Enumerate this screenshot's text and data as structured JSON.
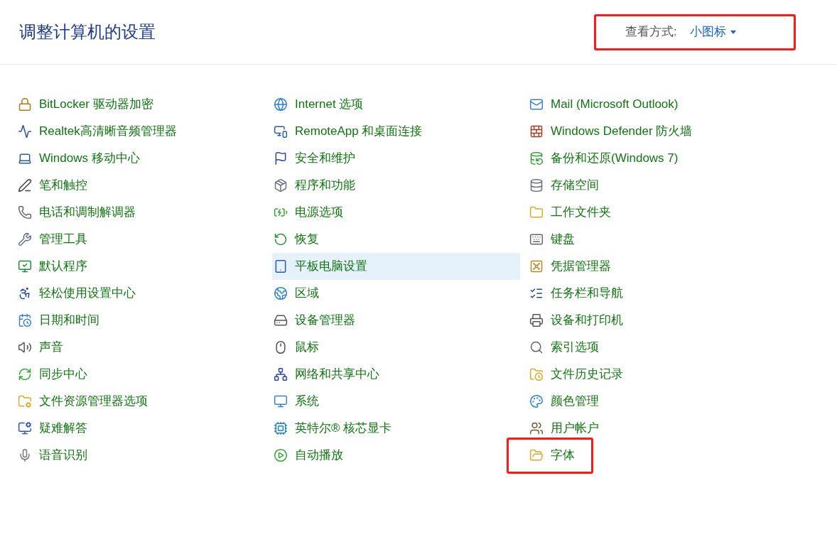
{
  "title": "调整计算机的设置",
  "view_by": {
    "label": "查看方式:",
    "value": "小图标",
    "marked": true
  },
  "columns": [
    [
      {
        "label": "BitLocker 驱动器加密",
        "selected": false,
        "marked": false
      },
      {
        "label": "Realtek高清晰音频管理器",
        "selected": false,
        "marked": false
      },
      {
        "label": "Windows 移动中心",
        "selected": false,
        "marked": false
      },
      {
        "label": "笔和触控",
        "selected": false,
        "marked": false
      },
      {
        "label": "电话和调制解调器",
        "selected": false,
        "marked": false
      },
      {
        "label": "管理工具",
        "selected": false,
        "marked": false
      },
      {
        "label": "默认程序",
        "selected": false,
        "marked": false
      },
      {
        "label": "轻松使用设置中心",
        "selected": false,
        "marked": false
      },
      {
        "label": "日期和时间",
        "selected": false,
        "marked": false
      },
      {
        "label": "声音",
        "selected": false,
        "marked": false
      },
      {
        "label": "同步中心",
        "selected": false,
        "marked": false
      },
      {
        "label": "文件资源管理器选项",
        "selected": false,
        "marked": false
      },
      {
        "label": "疑难解答",
        "selected": false,
        "marked": false
      },
      {
        "label": "语音识别",
        "selected": false,
        "marked": false
      }
    ],
    [
      {
        "label": "Internet 选项",
        "selected": false,
        "marked": false
      },
      {
        "label": "RemoteApp 和桌面连接",
        "selected": false,
        "marked": false
      },
      {
        "label": "安全和维护",
        "selected": false,
        "marked": false
      },
      {
        "label": "程序和功能",
        "selected": false,
        "marked": false
      },
      {
        "label": "电源选项",
        "selected": false,
        "marked": false
      },
      {
        "label": "恢复",
        "selected": false,
        "marked": false
      },
      {
        "label": "平板电脑设置",
        "selected": true,
        "marked": false
      },
      {
        "label": "区域",
        "selected": false,
        "marked": false
      },
      {
        "label": "设备管理器",
        "selected": false,
        "marked": false
      },
      {
        "label": "鼠标",
        "selected": false,
        "marked": false
      },
      {
        "label": "网络和共享中心",
        "selected": false,
        "marked": false
      },
      {
        "label": "系统",
        "selected": false,
        "marked": false
      },
      {
        "label": "英特尔® 核芯显卡",
        "selected": false,
        "marked": false
      },
      {
        "label": "自动播放",
        "selected": false,
        "marked": false
      }
    ],
    [
      {
        "label": "Mail (Microsoft Outlook)",
        "selected": false,
        "marked": false
      },
      {
        "label": "Windows Defender 防火墙",
        "selected": false,
        "marked": false
      },
      {
        "label": "备份和还原(Windows 7)",
        "selected": false,
        "marked": false
      },
      {
        "label": "存储空间",
        "selected": false,
        "marked": false
      },
      {
        "label": "工作文件夹",
        "selected": false,
        "marked": false
      },
      {
        "label": "键盘",
        "selected": false,
        "marked": false
      },
      {
        "label": "凭据管理器",
        "selected": false,
        "marked": false
      },
      {
        "label": "任务栏和导航",
        "selected": false,
        "marked": false
      },
      {
        "label": "设备和打印机",
        "selected": false,
        "marked": false
      },
      {
        "label": "索引选项",
        "selected": false,
        "marked": false
      },
      {
        "label": "文件历史记录",
        "selected": false,
        "marked": false
      },
      {
        "label": "颜色管理",
        "selected": false,
        "marked": false
      },
      {
        "label": "用户帐户",
        "selected": false,
        "marked": false
      },
      {
        "label": "字体",
        "selected": false,
        "marked": true
      }
    ]
  ]
}
